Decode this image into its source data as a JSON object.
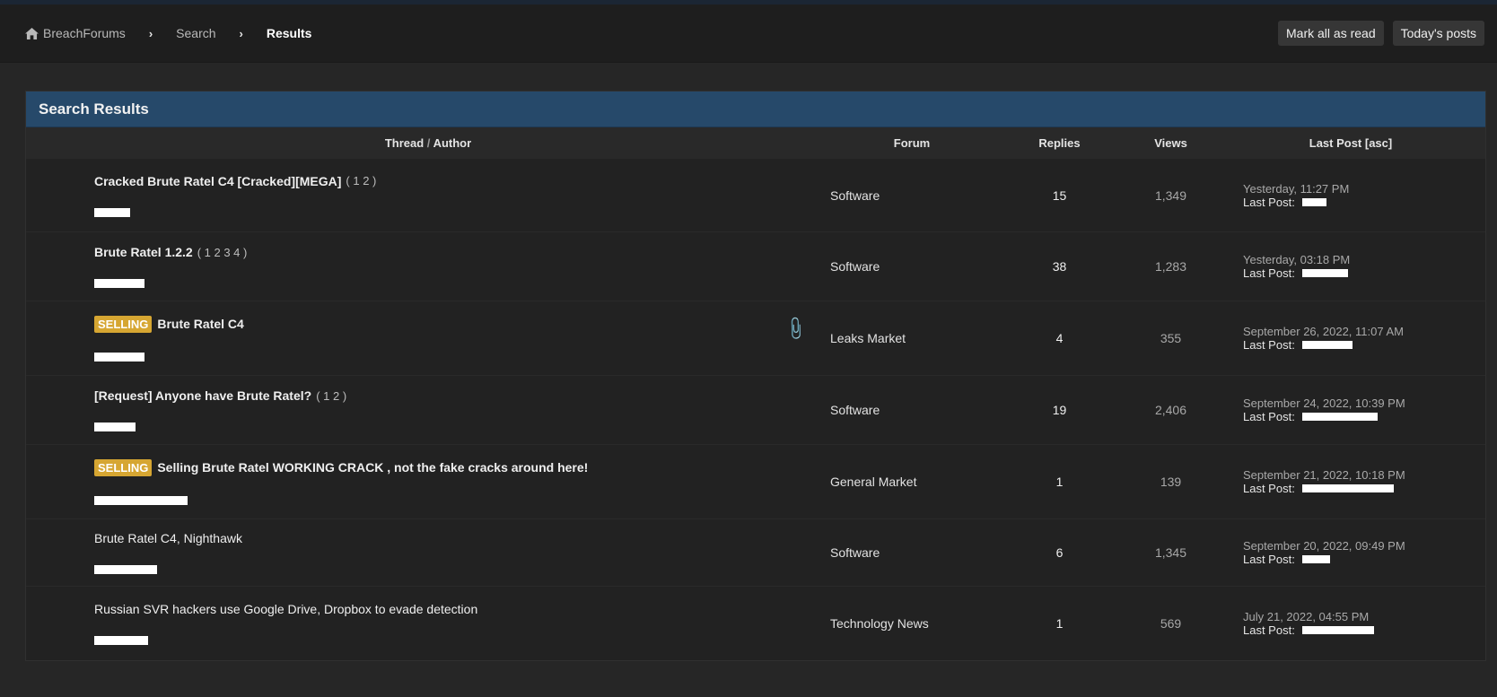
{
  "breadcrumb": {
    "home": "BreachForums",
    "search": "Search",
    "current": "Results",
    "separator": "›"
  },
  "nav_buttons": {
    "mark_read": "Mark all as read",
    "todays_posts": "Today's posts"
  },
  "panel": {
    "title": "Search Results"
  },
  "columns": {
    "thread": "Thread",
    "slash": "/",
    "author": "Author",
    "forum": "Forum",
    "replies": "Replies",
    "views": "Views",
    "last_post": "Last Post [asc]"
  },
  "last_post_label": "Last Post:",
  "rows": [
    {
      "prefix": "",
      "title": "Cracked Brute Ratel C4 [Cracked][MEGA]",
      "pages": "( 1 2 )",
      "forum": "Software",
      "replies": "15",
      "views": "1,349",
      "last_date": "Yesterday, 11:27 PM",
      "bold": true,
      "attachment": false
    },
    {
      "prefix": "",
      "title": "Brute Ratel 1.2.2",
      "pages": "( 1 2 3 4 )",
      "forum": "Software",
      "replies": "38",
      "views": "1,283",
      "last_date": "Yesterday, 03:18 PM",
      "bold": true,
      "attachment": false
    },
    {
      "prefix": "SELLING",
      "title": "Brute Ratel C4",
      "pages": "",
      "forum": "Leaks Market",
      "replies": "4",
      "views": "355",
      "last_date": "September 26, 2022, 11:07 AM",
      "bold": true,
      "attachment": true
    },
    {
      "prefix": "",
      "title": "[Request] Anyone have Brute Ratel?",
      "pages": "( 1 2 )",
      "forum": "Software",
      "replies": "19",
      "views": "2,406",
      "last_date": "September 24, 2022, 10:39 PM",
      "bold": true,
      "attachment": false
    },
    {
      "prefix": "SELLING",
      "title": "Selling Brute Ratel WORKING CRACK , not the fake cracks around here!",
      "pages": "",
      "forum": "General Market",
      "replies": "1",
      "views": "139",
      "last_date": "September 21, 2022, 10:18 PM",
      "bold": true,
      "attachment": false
    },
    {
      "prefix": "",
      "title": "Brute Ratel C4, Nighthawk",
      "pages": "",
      "forum": "Software",
      "replies": "6",
      "views": "1,345",
      "last_date": "September 20, 2022, 09:49 PM",
      "bold": false,
      "attachment": false
    },
    {
      "prefix": "",
      "title": "Russian SVR hackers use Google Drive, Dropbox to evade detection",
      "pages": "",
      "forum": "Technology News",
      "replies": "1",
      "views": "569",
      "last_date": "July 21, 2022, 04:55 PM",
      "bold": false,
      "attachment": false
    }
  ],
  "icons": {
    "home": "home-icon",
    "attachment": "paperclip-icon"
  },
  "colors": {
    "header_blue": "#26496a",
    "prefix_gold": "#d6a632"
  }
}
